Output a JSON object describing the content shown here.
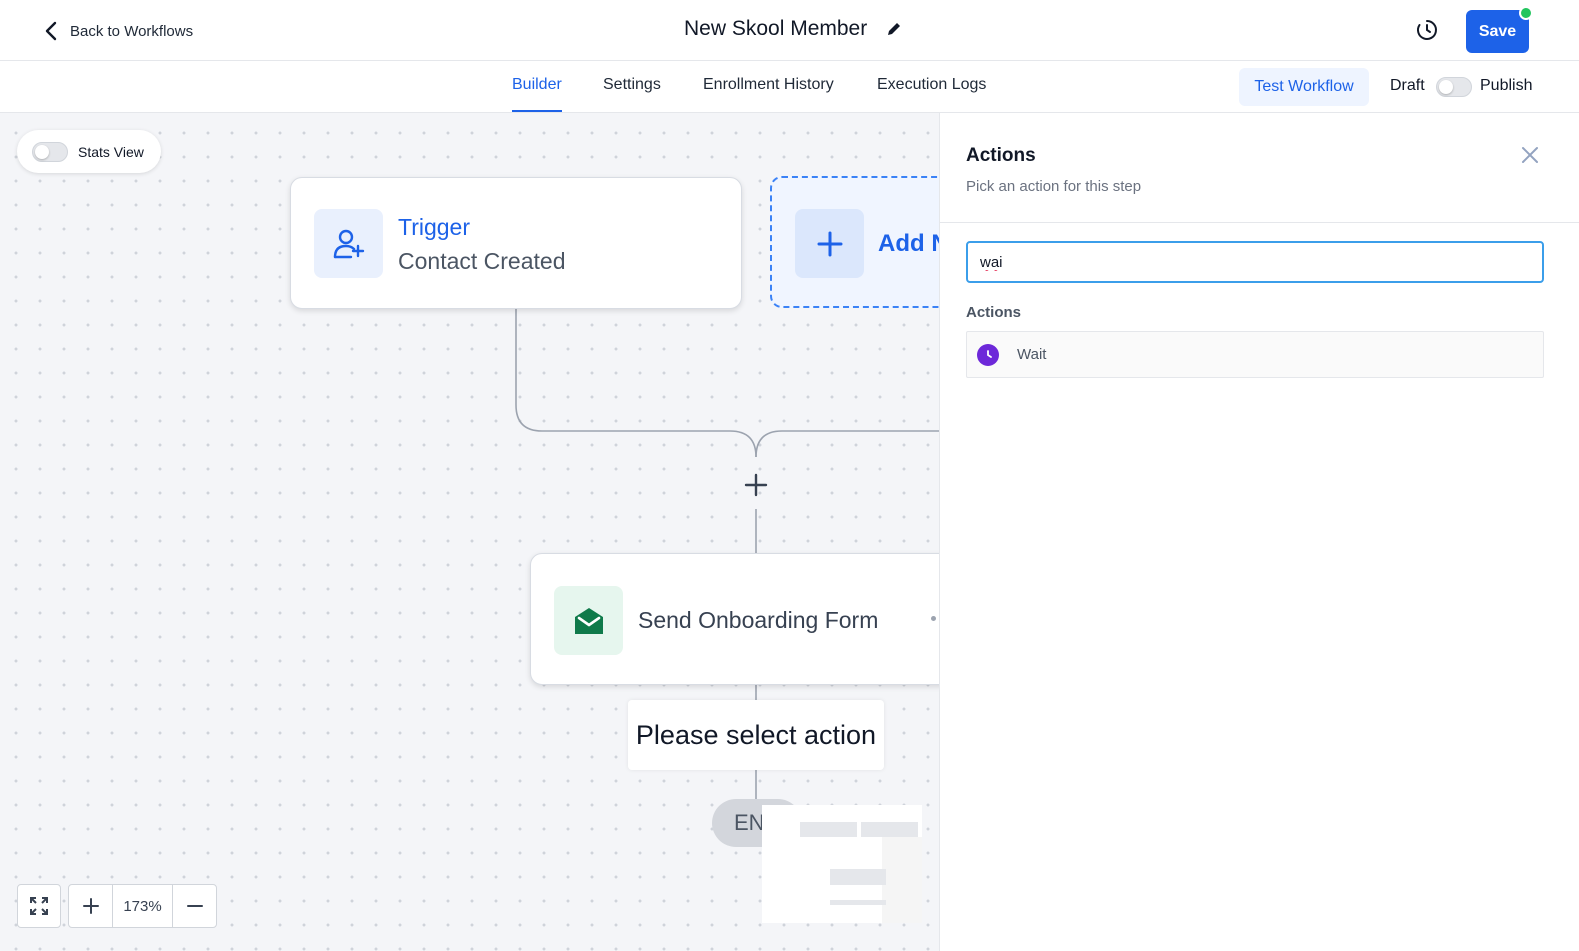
{
  "header": {
    "back_label": "Back to Workflows",
    "title": "New Skool Member",
    "save_label": "Save",
    "brand_color": "#1d62e8",
    "status_dot_color": "#22c55e"
  },
  "tabs": [
    {
      "label": "Builder",
      "active": true
    },
    {
      "label": "Settings",
      "active": false
    },
    {
      "label": "Enrollment History",
      "active": false
    },
    {
      "label": "Execution Logs",
      "active": false
    }
  ],
  "toolbar": {
    "test_label": "Test Workflow",
    "draft_label": "Draft",
    "publish_label": "Publish",
    "publish_toggle_on": false
  },
  "canvas": {
    "stats_view_label": "Stats View",
    "stats_view_on": false,
    "trigger": {
      "title": "Trigger",
      "subtitle": "Contact Created",
      "icon": "user-plus-icon"
    },
    "add_node": {
      "label": "Add N",
      "icon": "plus-icon"
    },
    "step": {
      "label": "Send Onboarding Form",
      "icon": "envelope-open-icon"
    },
    "select_action_label": "Please select action",
    "end_label": "EN",
    "zoom_level": "173%"
  },
  "panel": {
    "title": "Actions",
    "subtitle": "Pick an action for this step",
    "search_value": "wai",
    "section_label": "Actions",
    "results": [
      {
        "label": "Wait",
        "icon": "clock-icon",
        "icon_color": "#6d28d9"
      }
    ]
  }
}
